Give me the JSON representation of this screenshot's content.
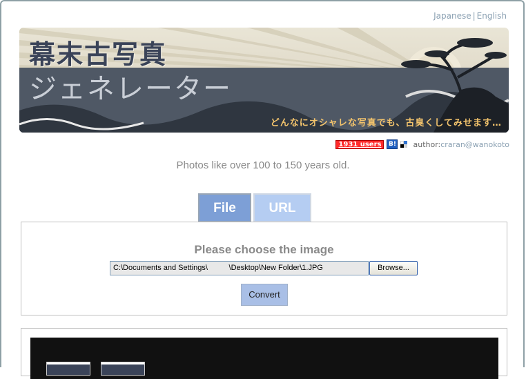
{
  "lang": {
    "japanese": "Japanese",
    "separator": "|",
    "english": "English"
  },
  "banner": {
    "title_line1": "幕末古写真",
    "title_line2": "ジェネレーター",
    "subtitle": "どんなにオシャレな写真でも、古臭くしてみせます…"
  },
  "meta": {
    "users_badge": "1931 users",
    "hatena_icon": "B!",
    "author_label": "author:",
    "author_name": "craran@wanokoto"
  },
  "tagline": "Photos like over 100 to 150 years old.",
  "tabs": [
    {
      "label": "File"
    },
    {
      "label": "URL"
    }
  ],
  "form": {
    "title": "Please choose the image",
    "file_value": "C:\\Documents and Settings\\          \\Desktop\\New Folder\\1.JPG",
    "browse_label": "Browse...",
    "convert_label": "Convert"
  },
  "colors": {
    "tab_active": "#7d9fd6",
    "tab_inactive": "#b5cdf2",
    "badge": "#ff2a2a",
    "link": "#8aa0b2"
  }
}
